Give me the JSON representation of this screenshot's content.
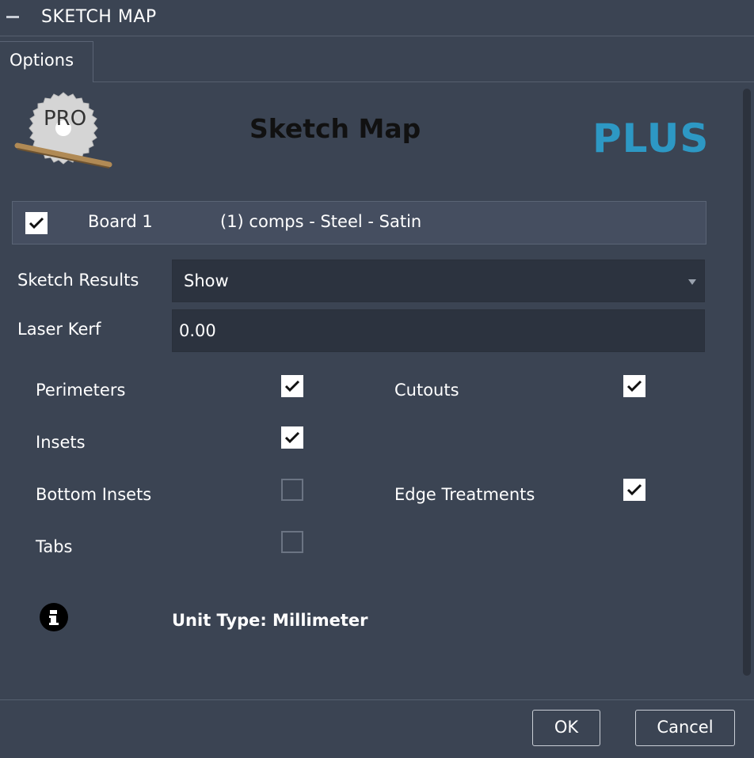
{
  "window": {
    "title": "SKETCH MAP"
  },
  "tabs": [
    {
      "label": "Options"
    }
  ],
  "header": {
    "logo_text": "PRO",
    "title": "Sketch Map",
    "edition": "PLUS"
  },
  "board": {
    "checked": true,
    "name": "Board 1",
    "material": "(1) comps - Steel - Satin"
  },
  "sketch_results": {
    "label": "Sketch Results",
    "value": "Show"
  },
  "laser_kerf": {
    "label": "Laser Kerf",
    "value": "0.00"
  },
  "options": {
    "perimeters": {
      "label": "Perimeters",
      "checked": true
    },
    "cutouts": {
      "label": "Cutouts",
      "checked": true
    },
    "insets": {
      "label": "Insets",
      "checked": true
    },
    "bottom_insets": {
      "label": "Bottom Insets",
      "checked": false
    },
    "edge_treatments": {
      "label": "Edge Treatments",
      "checked": true
    },
    "tabs": {
      "label": "Tabs",
      "checked": false
    }
  },
  "info": {
    "unit_text": "Unit Type: Millimeter"
  },
  "buttons": {
    "ok": "OK",
    "cancel": "Cancel"
  },
  "colors": {
    "background": "#3b4453",
    "accent_plus": "#2d98c4",
    "field_bg": "#2c333f"
  }
}
